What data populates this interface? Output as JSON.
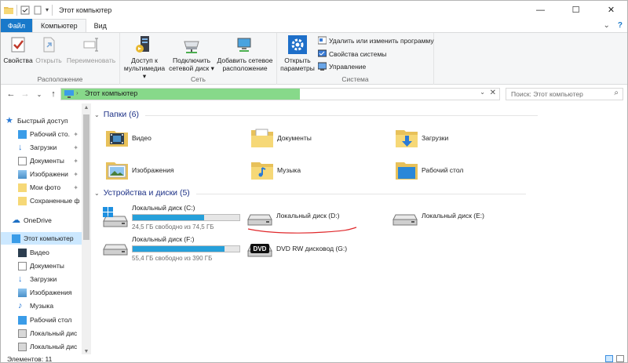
{
  "window": {
    "title": "Этот компьютер",
    "controls": {
      "minimize": "—",
      "maximize": "☐",
      "close": "✕"
    }
  },
  "ribbon_tabs": [
    {
      "label": "Файл"
    },
    {
      "label": "Компьютер"
    },
    {
      "label": "Вид"
    }
  ],
  "ribbon": {
    "location_group": {
      "name": "Расположение",
      "properties": "Свойства",
      "open": "Открыть",
      "rename": "Переименовать"
    },
    "network_group": {
      "name": "Сеть",
      "media_1": "Доступ к",
      "media_2": "мультимедиа",
      "map_1": "Подключить",
      "map_2": "сетевой диск",
      "addloc_1": "Добавить сетевое",
      "addloc_2": "расположение"
    },
    "system_group": {
      "name": "Система",
      "settings_1": "Открыть",
      "settings_2": "параметры",
      "uninstall": "Удалить или изменить программу",
      "sysprops": "Свойства системы",
      "manage": "Управление"
    }
  },
  "address": {
    "path": "Этот компьютер",
    "search_placeholder": "Поиск: Этот компьютер"
  },
  "nav_pane": {
    "quick_access": "Быстрый доступ",
    "quick_items": [
      {
        "label": "Рабочий сто.",
        "pinned": true
      },
      {
        "label": "Загрузки",
        "pinned": true
      },
      {
        "label": "Документы",
        "pinned": true
      },
      {
        "label": "Изображени",
        "pinned": true
      },
      {
        "label": "Мои фото",
        "pinned": true
      },
      {
        "label": "Сохраненные ф",
        "pinned": false
      }
    ],
    "onedrive": "OneDrive",
    "this_pc": "Этот компьютер",
    "pc_items": [
      {
        "label": "Видео"
      },
      {
        "label": "Документы"
      },
      {
        "label": "Загрузки"
      },
      {
        "label": "Изображения"
      },
      {
        "label": "Музыка"
      },
      {
        "label": "Рабочий стол"
      },
      {
        "label": "Локальный дис"
      },
      {
        "label": "Локальный дис"
      }
    ]
  },
  "folders_section": {
    "title": "Папки (6)",
    "items": [
      {
        "label": "Видео",
        "icon": "video-folder-icon"
      },
      {
        "label": "Документы",
        "icon": "documents-folder-icon"
      },
      {
        "label": "Загрузки",
        "icon": "downloads-folder-icon"
      },
      {
        "label": "Изображения",
        "icon": "pictures-folder-icon"
      },
      {
        "label": "Музыка",
        "icon": "music-folder-icon"
      },
      {
        "label": "Рабочий стол",
        "icon": "desktop-folder-icon"
      }
    ]
  },
  "drives_section": {
    "title": "Устройства и диски (5)",
    "drives": [
      {
        "name": "Локальный диск (C:)",
        "free": "24,5 ГБ свободно из 74,5 ГБ",
        "used_fraction": 0.67,
        "icon": "windows-drive-icon"
      },
      {
        "name": "Локальный диск (D:)",
        "free": "",
        "icon": "hard-drive-icon",
        "underlined": true
      },
      {
        "name": "Локальный диск (E:)",
        "free": "",
        "icon": "hard-drive-icon"
      },
      {
        "name": "Локальный диск (F:)",
        "free": "55,4 ГБ свободно из 390 ГБ",
        "used_fraction": 0.86,
        "icon": "hard-drive-icon"
      },
      {
        "name": "DVD RW дисковод (G:)",
        "free": "",
        "icon": "dvd-drive-icon",
        "dvd_label": "DVD"
      }
    ]
  },
  "status": {
    "items": "Элементов: 11"
  },
  "colors": {
    "accent": "#1979ca",
    "address_highlight": "#87d98a",
    "progress": "#26a0da",
    "annotation": "#e0282b"
  }
}
